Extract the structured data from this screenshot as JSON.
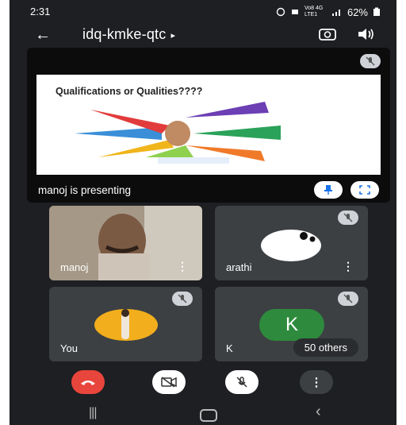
{
  "status": {
    "time": "2:31",
    "signal_text": "Vo8 4G LTE1",
    "battery": "62%"
  },
  "topbar": {
    "back": "←",
    "meeting_code": "idq-kmke-qtc",
    "caret": "▸"
  },
  "presentation": {
    "slide_title": "Qualifications or Qualities????",
    "presenter_label": "manoj is presenting"
  },
  "tiles": [
    {
      "name": "manoj"
    },
    {
      "name": "arathi"
    },
    {
      "name": "You"
    },
    {
      "name": "K",
      "avatar_letter": "K",
      "others": "50 others"
    }
  ],
  "colors": {
    "end_call": "#e8453c",
    "avatar_green": "#2e8b3d",
    "tile_bg": "#3c4043",
    "screen_bg": "#1e1f22"
  },
  "icons": {
    "end_call": "phone-hangup-icon",
    "camera": "camera-off-icon",
    "mic": "mic-off-icon",
    "more": "more-vert-icon"
  }
}
